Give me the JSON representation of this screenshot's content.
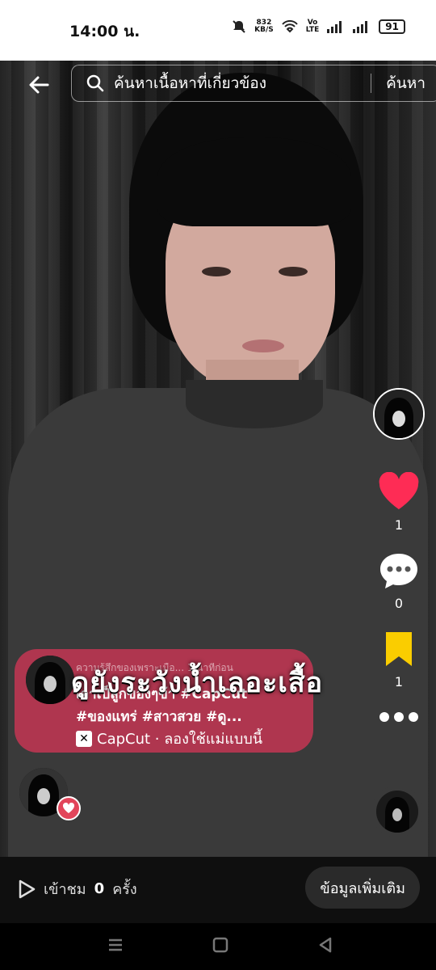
{
  "status_bar": {
    "time": "14:00 น.",
    "speed_value": "832",
    "speed_unit": "KB/S",
    "volte_top": "Vo",
    "volte_bottom": "LTE",
    "battery": "91"
  },
  "search": {
    "placeholder": "ค้นหาเนื้อหาที่เกี่ยวข้อง",
    "button": "ค้นหา"
  },
  "side_rail": {
    "likes": "1",
    "comments": "0",
    "saves": "1",
    "like_color": "#fe2c55",
    "save_color": "#facd00"
  },
  "video": {
    "overlay_caption": "ดูยังระวังน้ำเลอะเสื้อ"
  },
  "post_card": {
    "description_faded": "ความรู้สึกของเพราะเมือ... 1 นาทีก่อน",
    "line1": "เอาเป็ลูกของๆข้า #CapCut",
    "line2": "#ของแทร่ #สาวสวย #ดู...",
    "capcut_label": "CapCut · ลองใช้แม่แบบนี้",
    "background_color": "#c43654"
  },
  "info_bar": {
    "views_label": "เข้าชม",
    "views_count": "0",
    "views_unit": "ครั้ง",
    "more_button": "ข้อมูลเพิ่มเติม"
  },
  "icons": [
    "back-arrow-icon",
    "search-icon",
    "heart-icon",
    "comment-icon",
    "bookmark-icon",
    "more-icon",
    "play-icon",
    "menu-nav-icon",
    "home-nav-icon",
    "back-nav-icon"
  ]
}
